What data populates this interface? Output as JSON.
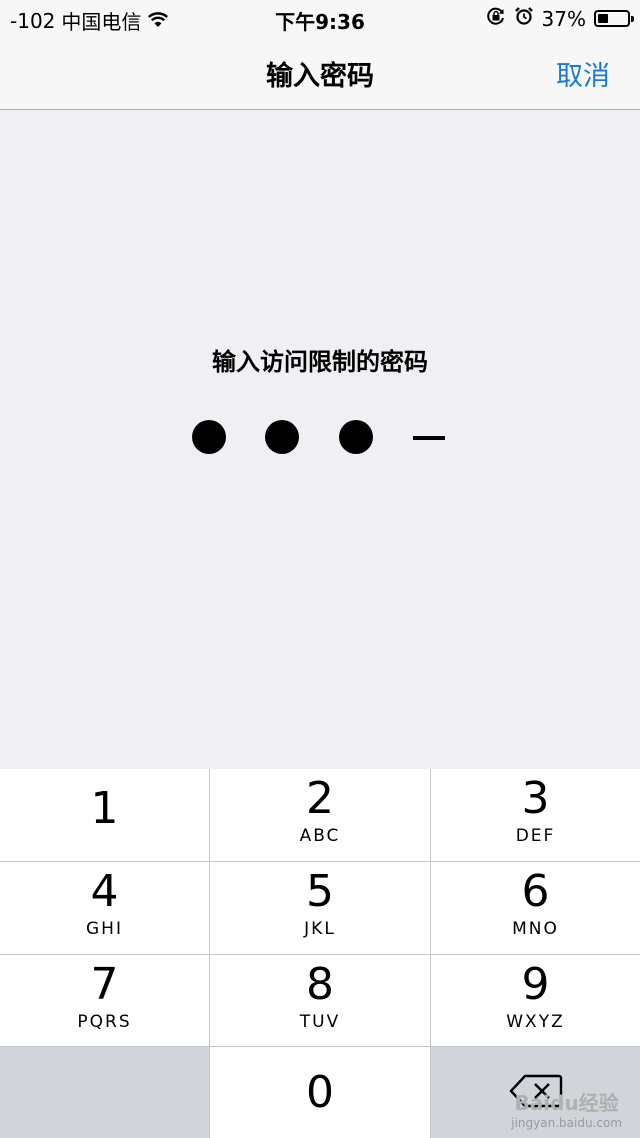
{
  "status": {
    "signal": "-102",
    "carrier": "中国电信",
    "time": "下午9:36",
    "battery": "37%",
    "battery_level": 0.37
  },
  "nav": {
    "title": "输入密码",
    "cancel": "取消"
  },
  "prompt": "输入访问限制的密码",
  "passcode": {
    "entered": 3,
    "length": 4
  },
  "keys": [
    {
      "num": "1",
      "letters": ""
    },
    {
      "num": "2",
      "letters": "ABC"
    },
    {
      "num": "3",
      "letters": "DEF"
    },
    {
      "num": "4",
      "letters": "GHI"
    },
    {
      "num": "5",
      "letters": "JKL"
    },
    {
      "num": "6",
      "letters": "MNO"
    },
    {
      "num": "7",
      "letters": "PQRS"
    },
    {
      "num": "8",
      "letters": "TUV"
    },
    {
      "num": "9",
      "letters": "WXYZ"
    },
    {
      "num": "0",
      "letters": ""
    }
  ],
  "icons": {
    "wifi": "wifi-icon",
    "rotation_lock": "rotation-lock-icon",
    "alarm": "alarm-icon",
    "battery": "battery-icon",
    "delete": "delete-backspace-icon"
  },
  "colors": {
    "accent": "#1a7bd6",
    "background": "#efeff4"
  },
  "watermark": {
    "brand": "Baidu经验",
    "url": "jingyan.baidu.com"
  }
}
